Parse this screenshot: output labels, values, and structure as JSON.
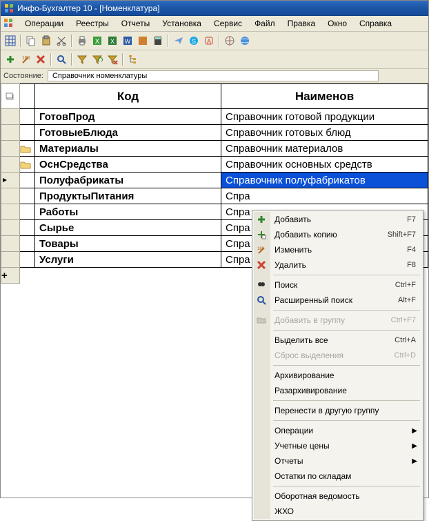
{
  "window": {
    "title": "Инфо-Бухгалтер 10 - [Номенклатура]"
  },
  "menubar": [
    "Операции",
    "Реестры",
    "Отчеты",
    "Установка",
    "Сервис",
    "Файл",
    "Правка",
    "Окно",
    "Справка"
  ],
  "status": {
    "label": "Состояние:",
    "value": "Справочник номенклатуры"
  },
  "columns": {
    "code": "Код",
    "name": "Наименов"
  },
  "rows": [
    {
      "folder": false,
      "code": "ГотовПрод",
      "name": "Справочник готовой продукции"
    },
    {
      "folder": false,
      "code": "ГотовыеБлюда",
      "name": "Справочник готовых блюд"
    },
    {
      "folder": true,
      "code": "Материалы",
      "name": "Справочник материалов"
    },
    {
      "folder": true,
      "code": "ОснСредства",
      "name": "Справочник основных средств"
    },
    {
      "folder": false,
      "code": "Полуфабрикаты",
      "name": "Справочник полуфабрикатов",
      "selected": true,
      "marker": true
    },
    {
      "folder": false,
      "code": "ПродуктыПитания",
      "name": "Спра"
    },
    {
      "folder": false,
      "code": "Работы",
      "name": "Спра"
    },
    {
      "folder": false,
      "code": "Сырье",
      "name": "Спра"
    },
    {
      "folder": false,
      "code": "Товары",
      "name": "Спра"
    },
    {
      "folder": false,
      "code": "Услуги",
      "name": "Спра"
    }
  ],
  "addrow": "+",
  "context_menu": [
    {
      "type": "item",
      "icon": "plus",
      "label": "Добавить",
      "shortcut": "F7"
    },
    {
      "type": "item",
      "icon": "copy",
      "label": "Добавить копию",
      "shortcut": "Shift+F7"
    },
    {
      "type": "item",
      "icon": "edit",
      "label": "Изменить",
      "shortcut": "F4"
    },
    {
      "type": "item",
      "icon": "del",
      "label": "Удалить",
      "shortcut": "F8"
    },
    {
      "type": "sep"
    },
    {
      "type": "item",
      "icon": "find",
      "label": "Поиск",
      "shortcut": "Ctrl+F"
    },
    {
      "type": "item",
      "icon": "findx",
      "label": "Расширенный поиск",
      "shortcut": "Alt+F"
    },
    {
      "type": "sep"
    },
    {
      "type": "item",
      "icon": "group",
      "label": "Добавить в группу",
      "shortcut": "Ctrl+F7",
      "disabled": true
    },
    {
      "type": "sep"
    },
    {
      "type": "item",
      "label": "Выделить все",
      "shortcut": "Ctrl+A"
    },
    {
      "type": "item",
      "label": "Сброс выделения",
      "shortcut": "Ctrl+D",
      "disabled": true
    },
    {
      "type": "sep"
    },
    {
      "type": "item",
      "label": "Архивирование"
    },
    {
      "type": "item",
      "label": "Разархивирование"
    },
    {
      "type": "sep"
    },
    {
      "type": "item",
      "label": "Перенести в другую группу"
    },
    {
      "type": "sep"
    },
    {
      "type": "item",
      "label": "Операции",
      "submenu": true
    },
    {
      "type": "item",
      "label": "Учетные цены",
      "submenu": true
    },
    {
      "type": "item",
      "label": "Отчеты",
      "submenu": true
    },
    {
      "type": "item",
      "label": "Остатки по складам"
    },
    {
      "type": "sep"
    },
    {
      "type": "item",
      "label": "Оборотная ведомость"
    },
    {
      "type": "item",
      "label": "ЖХО"
    }
  ]
}
